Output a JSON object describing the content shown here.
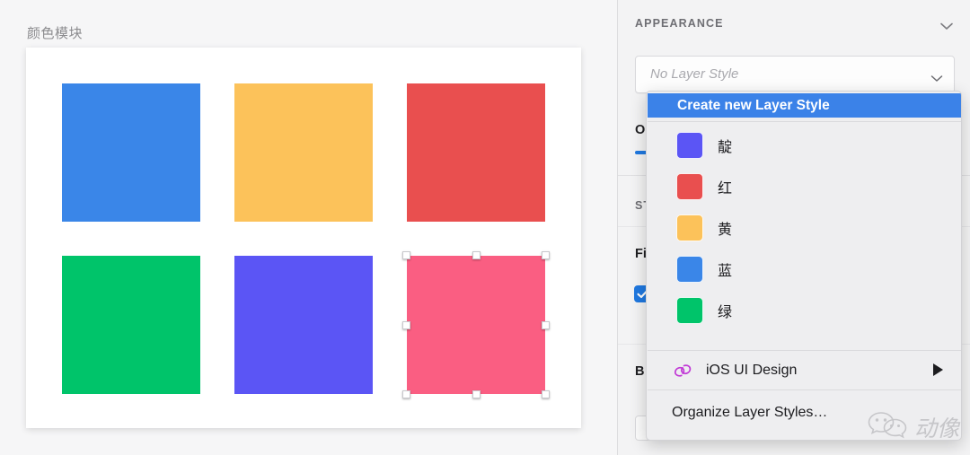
{
  "canvas": {
    "title": "颜色模块",
    "swatches": [
      {
        "name": "blue-square",
        "color": "#3a86e8",
        "selected": false
      },
      {
        "name": "yellow-square",
        "color": "#fcc25a",
        "selected": false
      },
      {
        "name": "red-square",
        "color": "#e94f4f",
        "selected": false
      },
      {
        "name": "green-square",
        "color": "#00c46a",
        "selected": false
      },
      {
        "name": "indigo-square",
        "color": "#5b55f5",
        "selected": false
      },
      {
        "name": "pink-square",
        "color": "#fa5e82",
        "selected": true
      }
    ]
  },
  "inspector": {
    "section_title": "APPEARANCE",
    "collapse_icon": "chevron-down-icon",
    "layer_style_select": {
      "value": "No Layer Style",
      "placeholder": "No Layer Style",
      "chevron_icon": "chevron-down-icon"
    },
    "occluded_rows": {
      "opacity_label": "O",
      "style_section_label": "ST",
      "fills_label": "Fi",
      "borders_label": "B"
    }
  },
  "dropdown": {
    "create_item": "Create new Layer Style",
    "color_styles": [
      {
        "label": "靛",
        "color": "#5b55f5"
      },
      {
        "label": "红",
        "color": "#e94f4f"
      },
      {
        "label": "黄",
        "color": "#fcc25a"
      },
      {
        "label": "蓝",
        "color": "#3a86e8"
      },
      {
        "label": "绿",
        "color": "#00c46a"
      }
    ],
    "folder_item": {
      "label": "iOS UI Design",
      "icon": "link-rings-icon",
      "icon_color": "#c13ad6",
      "submenu_icon": "triangle-right-icon"
    },
    "organize_item": "Organize Layer Styles…",
    "highlight_color": "#3b82e8"
  },
  "watermark": {
    "logo": "wechat-icon",
    "text": "动像"
  }
}
